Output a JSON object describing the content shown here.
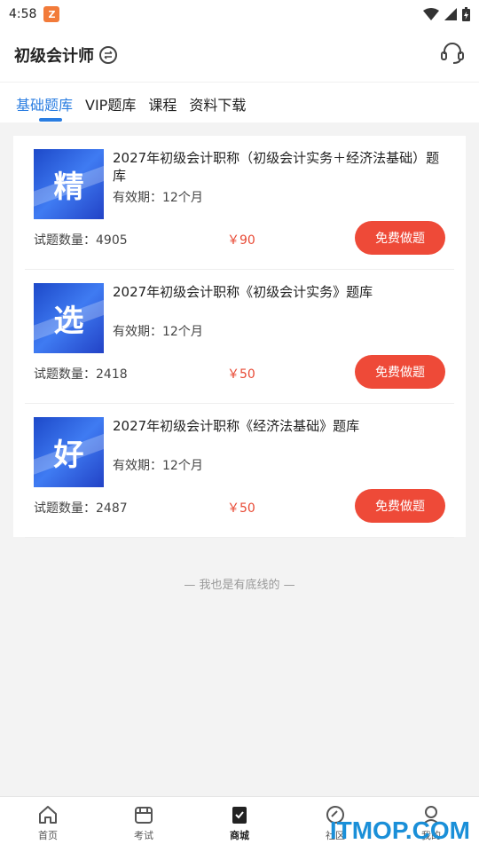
{
  "status_bar": {
    "time": "4:58",
    "app_icon_letter": "Z"
  },
  "header": {
    "title": "初级会计师"
  },
  "tabs": [
    {
      "label": "基础题库",
      "active": true
    },
    {
      "label": "VIP题库",
      "active": false
    },
    {
      "label": "课程",
      "active": false
    },
    {
      "label": "资料下载",
      "active": false
    }
  ],
  "items": [
    {
      "cover_char": "精",
      "title": "2027年初级会计职称（初级会计实务＋经济法基础）题库",
      "validity": "有效期：12个月",
      "count": "试题数量：4905",
      "price": "￥90",
      "button": "免费做题"
    },
    {
      "cover_char": "选",
      "title": "2027年初级会计职称《初级会计实务》题库",
      "validity": "有效期：12个月",
      "count": "试题数量：2418",
      "price": "￥50",
      "button": "免费做题"
    },
    {
      "cover_char": "好",
      "title": "2027年初级会计职称《经济法基础》题库",
      "validity": "有效期：12个月",
      "count": "试题数量：2487",
      "price": "￥50",
      "button": "免费做题"
    }
  ],
  "end_note": "— 我也是有底线的 —",
  "bottom_nav": [
    {
      "label": "首页",
      "icon": "home-icon"
    },
    {
      "label": "考试",
      "icon": "exam-icon"
    },
    {
      "label": "商城",
      "icon": "mall-icon",
      "active": true
    },
    {
      "label": "社区",
      "icon": "community-icon"
    },
    {
      "label": "我的",
      "icon": "profile-icon"
    }
  ],
  "watermark": "ITMOP.COM",
  "colors": {
    "accent": "#2a7de1",
    "button": "#ee4a38",
    "price": "#e84a35"
  }
}
